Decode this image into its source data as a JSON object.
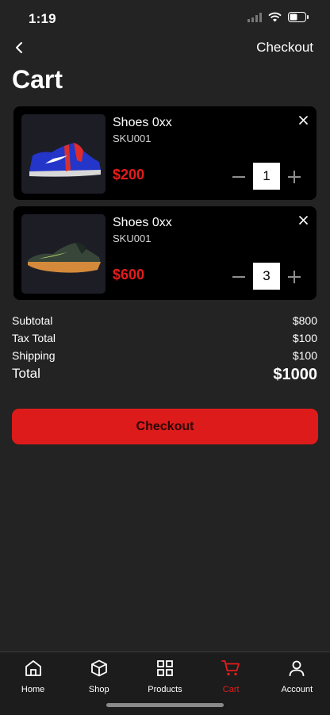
{
  "status_bar": {
    "time": "1:19"
  },
  "nav": {
    "right_link": "Checkout"
  },
  "page": {
    "title": "Cart"
  },
  "cart_items": [
    {
      "name": "Shoes 0xx",
      "sku": "SKU001",
      "price": "$200",
      "quantity": "1",
      "image": "blue-nike-sneaker"
    },
    {
      "name": "Shoes 0xx",
      "sku": "SKU001",
      "price": "$600",
      "quantity": "3",
      "image": "green-orange-nike-sneaker"
    }
  ],
  "summary": {
    "subtotal_label": "Subtotal",
    "subtotal_value": "$800",
    "tax_label": "Tax Total",
    "tax_value": "$100",
    "shipping_label": "Shipping",
    "shipping_value": "$100",
    "total_label": "Total",
    "total_value": "$1000"
  },
  "checkout_button": "Checkout",
  "tabs": [
    {
      "label": "Home",
      "icon": "home-icon"
    },
    {
      "label": "Shop",
      "icon": "box-icon"
    },
    {
      "label": "Products",
      "icon": "grid-icon"
    },
    {
      "label": "Cart",
      "icon": "cart-icon",
      "active": true
    },
    {
      "label": "Account",
      "icon": "user-icon"
    }
  ],
  "colors": {
    "accent": "#e21d1d",
    "background": "#232323",
    "card": "#000000"
  }
}
